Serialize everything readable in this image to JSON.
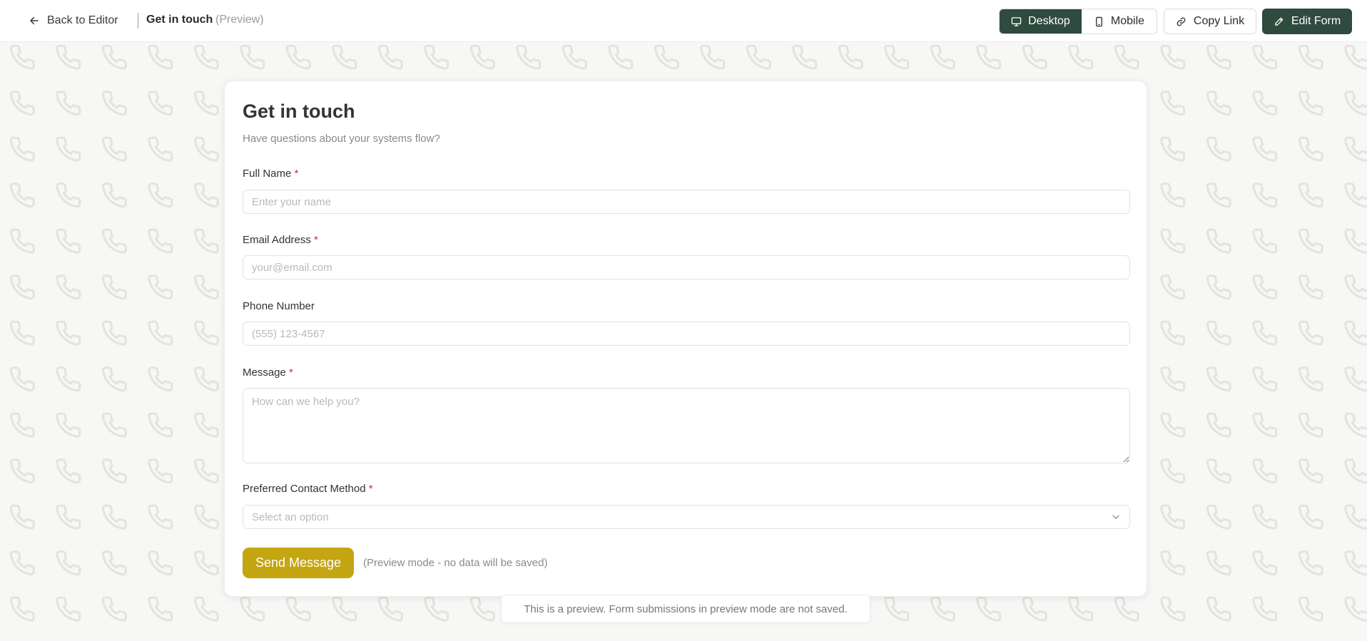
{
  "header": {
    "back_label": "Back to Editor",
    "title": "Get in touch",
    "preview_tag": "(Preview)",
    "view_toggle": {
      "desktop_label": "Desktop",
      "mobile_label": "Mobile",
      "selected": "Desktop"
    },
    "copy_link_label": "Copy Link",
    "edit_form_label": "Edit Form"
  },
  "form": {
    "title": "Get in touch",
    "subtitle": "Have questions about your systems flow?",
    "fields": [
      {
        "label": "Full Name",
        "required": true,
        "placeholder": "Enter your name",
        "value": ""
      },
      {
        "label": "Email Address",
        "required": true,
        "placeholder": "your@email.com",
        "value": ""
      },
      {
        "label": "Phone Number",
        "required": false,
        "placeholder": "(555) 123-4567",
        "value": ""
      },
      {
        "label": "Message",
        "required": true,
        "placeholder": "How can we help you?",
        "value": ""
      },
      {
        "label": "Preferred Contact Method",
        "required": true,
        "placeholder": "Select an option",
        "value": ""
      }
    ],
    "required_marker": "*",
    "submit_label": "Send Message",
    "submit_note": "(Preview mode - no data will be saved)"
  },
  "toast": {
    "text": "This is a preview. Form submissions in preview mode are not saved."
  },
  "colors": {
    "primary_dark": "#2f4a3f",
    "submit_button": "#c4a512",
    "required_marker": "#c0392b",
    "background_pattern": "#e6e6e3"
  },
  "icons": {
    "back": "arrow-left-icon",
    "desktop": "monitor-icon",
    "mobile": "smartphone-icon",
    "copy": "link-icon",
    "edit": "pencil-icon",
    "select": "chevron-down-icon",
    "background": "phone-icon"
  }
}
